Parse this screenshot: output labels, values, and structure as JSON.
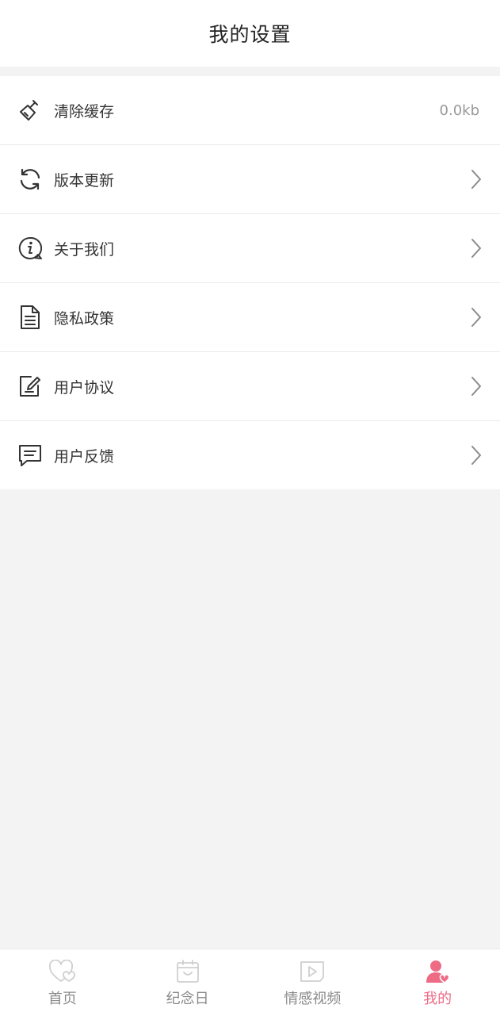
{
  "header": {
    "title": "我的设置"
  },
  "settings": {
    "items": [
      {
        "label": "清除缓存",
        "value": "0.0kb",
        "icon": "broom-icon"
      },
      {
        "label": "版本更新",
        "icon": "refresh-icon"
      },
      {
        "label": "关于我们",
        "icon": "info-icon"
      },
      {
        "label": "隐私政策",
        "icon": "document-icon"
      },
      {
        "label": "用户协议",
        "icon": "edit-document-icon"
      },
      {
        "label": "用户反馈",
        "icon": "message-icon"
      }
    ]
  },
  "tabbar": {
    "tabs": [
      {
        "label": "首页",
        "icon": "heart-icon",
        "active": false
      },
      {
        "label": "纪念日",
        "icon": "calendar-icon",
        "active": false
      },
      {
        "label": "情感视频",
        "icon": "video-icon",
        "active": false
      },
      {
        "label": "我的",
        "icon": "user-heart-icon",
        "active": true
      }
    ]
  },
  "colors": {
    "accent": "#ee6b86",
    "background": "#f3f3f3",
    "divider": "#e9e9e9",
    "muted_text": "#999999",
    "tab_inactive": "#8a8a8a"
  }
}
